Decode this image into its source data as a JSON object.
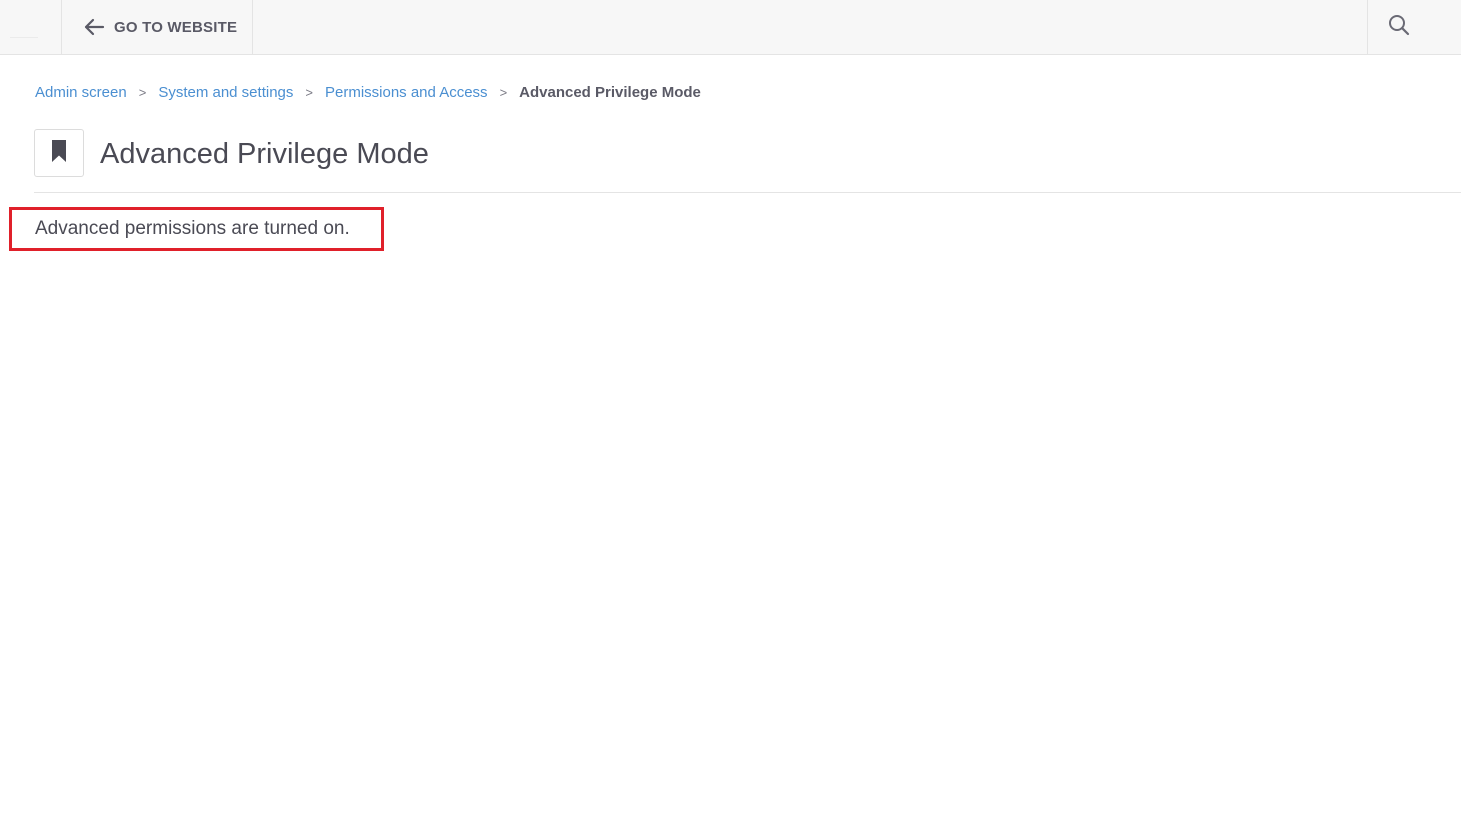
{
  "topbar": {
    "go_to_website_label": "GO TO WEBSITE",
    "icons": {
      "back": "arrow-left-icon",
      "search": "search-icon"
    }
  },
  "breadcrumb": {
    "items": [
      {
        "label": "Admin screen"
      },
      {
        "label": "System and settings"
      },
      {
        "label": "Permissions and Access"
      }
    ],
    "separator": ">",
    "current": "Advanced Privilege Mode"
  },
  "page": {
    "title": "Advanced Privilege Mode",
    "icon": "bookmark-icon"
  },
  "status": {
    "message": "Advanced permissions are turned on.",
    "highlight_color": "#e0202a"
  },
  "colors": {
    "link": "#4b8fd1",
    "text": "#4a4a54",
    "topbar_bg": "#f7f7f7"
  }
}
